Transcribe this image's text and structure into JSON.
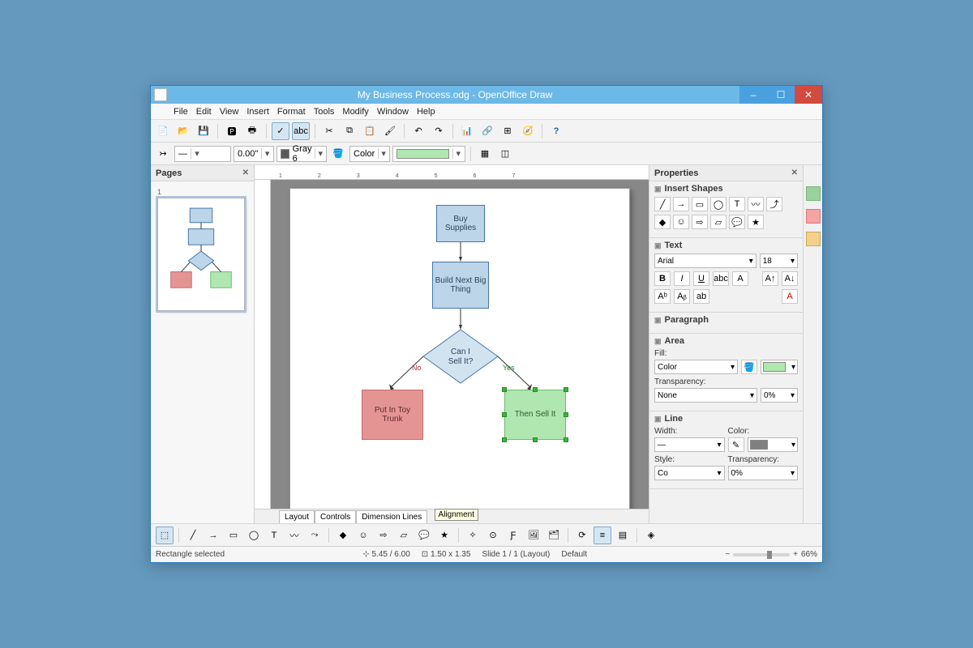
{
  "titlebar": {
    "text": "My Business Process.odg - OpenOffice Draw"
  },
  "menubar": [
    "File",
    "Edit",
    "View",
    "Insert",
    "Format",
    "Tools",
    "Modify",
    "Window",
    "Help"
  ],
  "toolbar2": {
    "lineWidth": "0.00\"",
    "lineColorName": "Gray 6",
    "fillModeLabel": "Color"
  },
  "pagesPanel": {
    "title": "Pages",
    "thumbLabel": "1"
  },
  "flowchart": {
    "box1": "Buy Supplies",
    "box2": "Build Next Big Thing",
    "decision": "Can I Sell It?",
    "noLabel": "No",
    "yesLabel": "Yes",
    "boxNo": "Put In Toy Trunk",
    "boxYes": "Then Sell It"
  },
  "tabs": [
    "Layout",
    "Controls",
    "Dimension Lines"
  ],
  "tooltip": "Alignment",
  "properties": {
    "title": "Properties",
    "sections": {
      "insertShapes": "Insert Shapes",
      "text": "Text",
      "fontName": "Arial",
      "fontSize": "18",
      "paragraph": "Paragraph",
      "area": "Area",
      "fillLabel": "Fill:",
      "fillMode": "Color",
      "transparencyLabel": "Transparency:",
      "transparencyMode": "None",
      "transparencyVal": "0%",
      "line": "Line",
      "widthLabel": "Width:",
      "colorLabel": "Color:",
      "styleLabel": "Style:",
      "styleVal": "Co",
      "lineTransVal": "0%"
    }
  },
  "status": {
    "selection": "Rectangle selected",
    "pos": "5.45 / 6.00",
    "size": "1.50 x 1.35",
    "slide": "Slide 1 / 1 (Layout)",
    "master": "Default",
    "zoom": "66%"
  }
}
